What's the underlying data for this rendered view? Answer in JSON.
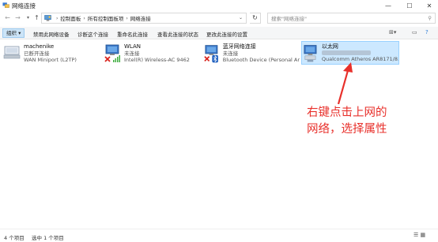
{
  "window": {
    "title": "网络连接"
  },
  "nav": {
    "breadcrumb": [
      "控制面板",
      "所有控制面板项",
      "网络连接"
    ],
    "search_placeholder": "搜索\"网络连接\""
  },
  "toolbar": {
    "organize": "组织 ▾",
    "commands": [
      "禁用此网络设备",
      "诊断这个连接",
      "重命名此连接",
      "查看此连接的状态",
      "更改此连接的设置"
    ]
  },
  "connections": [
    {
      "name": "machenike",
      "status": "已断开连接",
      "device": "WAN Miniport (L2TP)",
      "icon": "vpn-connection-icon",
      "state": "disconnected"
    },
    {
      "name": "WLAN",
      "status": "未连接",
      "device": "Intel(R) Wireless-AC 9462",
      "icon": "wireless-icon",
      "state": "disconnected"
    },
    {
      "name": "蓝牙网络连接",
      "status": "未连接",
      "device": "Bluetooth Device (Personal Ar...",
      "icon": "bluetooth-icon",
      "state": "disconnected"
    },
    {
      "name": "以太网",
      "status": "",
      "device": "Qualcomm Atheros AR8171/8...",
      "icon": "ethernet-icon",
      "state": "connected",
      "selected": true
    }
  ],
  "annotation": {
    "line1": "右键点击上网的",
    "line2": "网络，选择属性",
    "color": "#e8302b"
  },
  "statusbar": {
    "count": "4 个项目",
    "selected": "选中 1 个项目"
  }
}
